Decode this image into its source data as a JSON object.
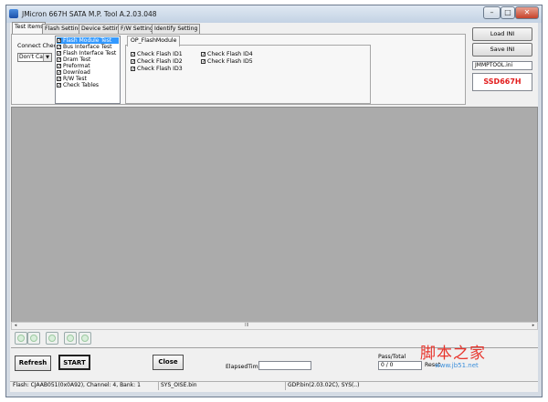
{
  "window": {
    "title": "JMicron 667H SATA M.P. Tool A.2.03.048",
    "minimize_glyph": "–",
    "maximize_glyph": "□",
    "close_glyph": "✕"
  },
  "tabs": [
    "Test Items",
    "Flash Setting",
    "Device Setting",
    "F/W Setting",
    "Identify Setting"
  ],
  "connect_check": {
    "label": "Connect Check",
    "value": "Don't Care"
  },
  "test_items": [
    {
      "label": "Flash Module Test",
      "checked": true,
      "selected": true
    },
    {
      "label": "Bus Interface Test",
      "checked": true,
      "selected": false
    },
    {
      "label": "Flash Interface Test",
      "checked": true,
      "selected": false
    },
    {
      "label": "Dram Test",
      "checked": true,
      "selected": false
    },
    {
      "label": "Preformat",
      "checked": true,
      "selected": false
    },
    {
      "label": "Download",
      "checked": true,
      "selected": false
    },
    {
      "label": "R/W Test",
      "checked": true,
      "selected": false
    },
    {
      "label": "Check Tables",
      "checked": true,
      "selected": false
    }
  ],
  "op_module": {
    "tab_label": "OP_FlashModule",
    "checks": [
      {
        "label": "Check Flash ID1",
        "checked": true
      },
      {
        "label": "Check Flash ID2",
        "checked": true
      },
      {
        "label": "Check Flash ID3",
        "checked": true
      },
      {
        "label": "Check Flash ID4",
        "checked": true
      },
      {
        "label": "Check Flash ID5",
        "checked": true
      }
    ]
  },
  "right_panel": {
    "load_ini": "Load INI",
    "save_ini": "Save INI",
    "ini_file": "JMMPTOOL.ini",
    "model": "SSD667H"
  },
  "scroll_grip": "III",
  "buttons": {
    "refresh": "Refresh",
    "start": "START",
    "close": "Close"
  },
  "elapsed": {
    "label": "ElapsedTime",
    "value": ""
  },
  "pass_total": {
    "label": "Pass/Total",
    "value": "0 / 0",
    "reset": "Reset"
  },
  "status": {
    "flash": "Flash: CJAAB051(0x0A92), Channel: 4, Bank: 1",
    "sys": "SYS_OISE.bin",
    "gdp": "GDP.bin(2.03.02C), SYS(..)"
  },
  "watermark": {
    "cn": "脚本之家",
    "url": "www.jb51.net"
  },
  "colors": {
    "accent_red": "#e21b1b",
    "selection": "#3399ff",
    "log_area": "#ababab"
  }
}
